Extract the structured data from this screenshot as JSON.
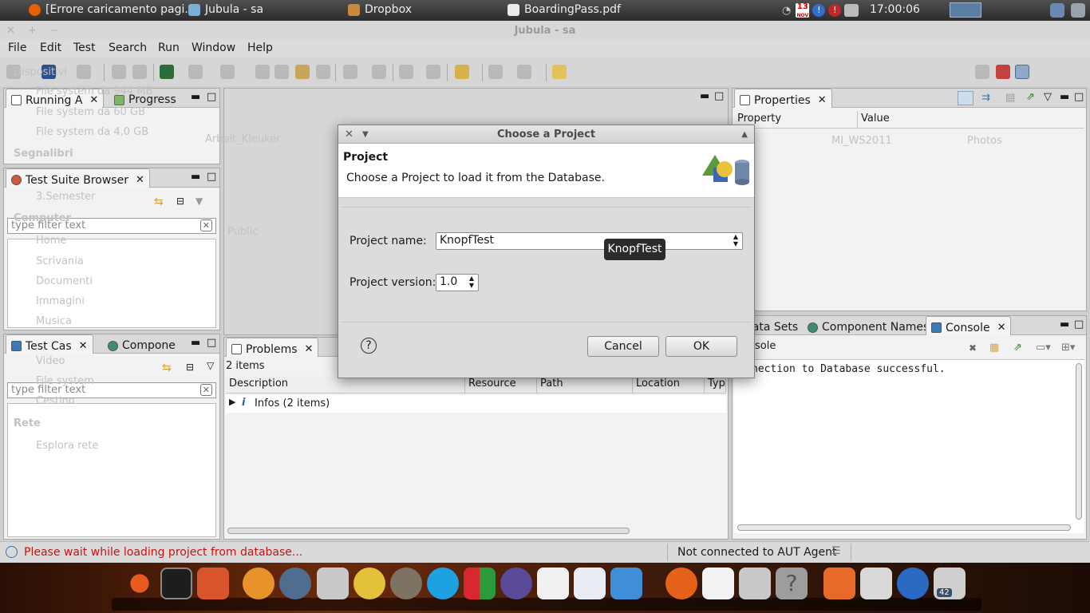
{
  "taskbar": {
    "tasks": [
      {
        "label": "[Errore caricamento pagi...",
        "icon": "firefox-icon"
      },
      {
        "label": "Jubula - sa",
        "icon": "jubula-icon"
      },
      {
        "label": "Dropbox",
        "icon": "folder-icon"
      },
      {
        "label": "BoardingPass.pdf",
        "icon": "document-icon"
      }
    ],
    "calendar_day": "13",
    "calendar_month": "NOV",
    "clock": "17:00:06"
  },
  "window": {
    "title": "Jubula - sa"
  },
  "menu": [
    "File",
    "Edit",
    "Test",
    "Search",
    "Run",
    "Window",
    "Help"
  ],
  "panels": {
    "top_left_tabs": [
      "Running A",
      "Progress"
    ],
    "browser_tab": "Test Suite Browser",
    "browser_filter_placeholder": "type filter text",
    "bottom_left_tabs": [
      "Test Cas",
      "Compone"
    ],
    "testcase_filter_placeholder": "type filter text",
    "properties_tab": "Properties",
    "properties_columns": [
      "Property",
      "Value"
    ],
    "console_tabs": [
      "Data Sets",
      "Component Names",
      "Console"
    ],
    "console_label": "sole",
    "console_text": "nection to Database successful.",
    "problems_tab": "Problems",
    "problems_count": "2 items",
    "problems_columns": [
      "Description",
      "Resource",
      "Path",
      "Location",
      "Type"
    ],
    "problems_row": "Infos (2 items)"
  },
  "background_ghost": {
    "left": [
      "Dispositivi",
      "File system da 944 MB",
      "File system da 60 GB",
      "File system da 4,0 GB",
      "Segnalibri",
      "3.Semester",
      "Computer",
      "Home",
      "Scrivania",
      "Documenti",
      "Immagini",
      "Musica",
      "Video",
      "File system",
      "Cestino",
      "Rete",
      "Esplora rete"
    ],
    "mid": [
      "Arbeit_Kleuker",
      "Public",
      "MI_WS2011",
      "Photos"
    ]
  },
  "dialog": {
    "title": "Choose a Project",
    "header_title": "Project",
    "header_desc": "Choose a Project to load it from the Database.",
    "name_label": "Project name:",
    "name_value": "KnopfTest",
    "version_label": "Project version:",
    "version_value": "1.0",
    "tooltip": "KnopfTest",
    "cancel": "Cancel",
    "ok": "OK"
  },
  "status": {
    "message": "Please wait while loading project from database...",
    "aut": "Not connected to AUT Agent"
  },
  "dock": {
    "badge": "42"
  },
  "colors": {
    "status_error": "#cc1111",
    "dock_accent": "#6b2a0b"
  }
}
